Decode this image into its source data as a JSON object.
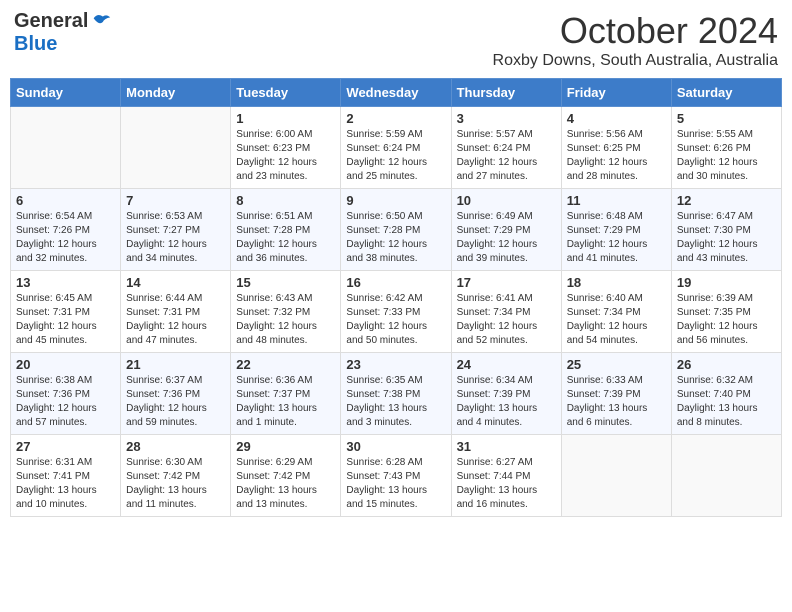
{
  "header": {
    "logo_general": "General",
    "logo_blue": "Blue",
    "month": "October 2024",
    "location": "Roxby Downs, South Australia, Australia"
  },
  "days_of_week": [
    "Sunday",
    "Monday",
    "Tuesday",
    "Wednesday",
    "Thursday",
    "Friday",
    "Saturday"
  ],
  "weeks": [
    [
      {
        "day": "",
        "sunrise": "",
        "sunset": "",
        "daylight": ""
      },
      {
        "day": "",
        "sunrise": "",
        "sunset": "",
        "daylight": ""
      },
      {
        "day": "1",
        "sunrise": "Sunrise: 6:00 AM",
        "sunset": "Sunset: 6:23 PM",
        "daylight": "Daylight: 12 hours and 23 minutes."
      },
      {
        "day": "2",
        "sunrise": "Sunrise: 5:59 AM",
        "sunset": "Sunset: 6:24 PM",
        "daylight": "Daylight: 12 hours and 25 minutes."
      },
      {
        "day": "3",
        "sunrise": "Sunrise: 5:57 AM",
        "sunset": "Sunset: 6:24 PM",
        "daylight": "Daylight: 12 hours and 27 minutes."
      },
      {
        "day": "4",
        "sunrise": "Sunrise: 5:56 AM",
        "sunset": "Sunset: 6:25 PM",
        "daylight": "Daylight: 12 hours and 28 minutes."
      },
      {
        "day": "5",
        "sunrise": "Sunrise: 5:55 AM",
        "sunset": "Sunset: 6:26 PM",
        "daylight": "Daylight: 12 hours and 30 minutes."
      }
    ],
    [
      {
        "day": "6",
        "sunrise": "Sunrise: 6:54 AM",
        "sunset": "Sunset: 7:26 PM",
        "daylight": "Daylight: 12 hours and 32 minutes."
      },
      {
        "day": "7",
        "sunrise": "Sunrise: 6:53 AM",
        "sunset": "Sunset: 7:27 PM",
        "daylight": "Daylight: 12 hours and 34 minutes."
      },
      {
        "day": "8",
        "sunrise": "Sunrise: 6:51 AM",
        "sunset": "Sunset: 7:28 PM",
        "daylight": "Daylight: 12 hours and 36 minutes."
      },
      {
        "day": "9",
        "sunrise": "Sunrise: 6:50 AM",
        "sunset": "Sunset: 7:28 PM",
        "daylight": "Daylight: 12 hours and 38 minutes."
      },
      {
        "day": "10",
        "sunrise": "Sunrise: 6:49 AM",
        "sunset": "Sunset: 7:29 PM",
        "daylight": "Daylight: 12 hours and 39 minutes."
      },
      {
        "day": "11",
        "sunrise": "Sunrise: 6:48 AM",
        "sunset": "Sunset: 7:29 PM",
        "daylight": "Daylight: 12 hours and 41 minutes."
      },
      {
        "day": "12",
        "sunrise": "Sunrise: 6:47 AM",
        "sunset": "Sunset: 7:30 PM",
        "daylight": "Daylight: 12 hours and 43 minutes."
      }
    ],
    [
      {
        "day": "13",
        "sunrise": "Sunrise: 6:45 AM",
        "sunset": "Sunset: 7:31 PM",
        "daylight": "Daylight: 12 hours and 45 minutes."
      },
      {
        "day": "14",
        "sunrise": "Sunrise: 6:44 AM",
        "sunset": "Sunset: 7:31 PM",
        "daylight": "Daylight: 12 hours and 47 minutes."
      },
      {
        "day": "15",
        "sunrise": "Sunrise: 6:43 AM",
        "sunset": "Sunset: 7:32 PM",
        "daylight": "Daylight: 12 hours and 48 minutes."
      },
      {
        "day": "16",
        "sunrise": "Sunrise: 6:42 AM",
        "sunset": "Sunset: 7:33 PM",
        "daylight": "Daylight: 12 hours and 50 minutes."
      },
      {
        "day": "17",
        "sunrise": "Sunrise: 6:41 AM",
        "sunset": "Sunset: 7:34 PM",
        "daylight": "Daylight: 12 hours and 52 minutes."
      },
      {
        "day": "18",
        "sunrise": "Sunrise: 6:40 AM",
        "sunset": "Sunset: 7:34 PM",
        "daylight": "Daylight: 12 hours and 54 minutes."
      },
      {
        "day": "19",
        "sunrise": "Sunrise: 6:39 AM",
        "sunset": "Sunset: 7:35 PM",
        "daylight": "Daylight: 12 hours and 56 minutes."
      }
    ],
    [
      {
        "day": "20",
        "sunrise": "Sunrise: 6:38 AM",
        "sunset": "Sunset: 7:36 PM",
        "daylight": "Daylight: 12 hours and 57 minutes."
      },
      {
        "day": "21",
        "sunrise": "Sunrise: 6:37 AM",
        "sunset": "Sunset: 7:36 PM",
        "daylight": "Daylight: 12 hours and 59 minutes."
      },
      {
        "day": "22",
        "sunrise": "Sunrise: 6:36 AM",
        "sunset": "Sunset: 7:37 PM",
        "daylight": "Daylight: 13 hours and 1 minute."
      },
      {
        "day": "23",
        "sunrise": "Sunrise: 6:35 AM",
        "sunset": "Sunset: 7:38 PM",
        "daylight": "Daylight: 13 hours and 3 minutes."
      },
      {
        "day": "24",
        "sunrise": "Sunrise: 6:34 AM",
        "sunset": "Sunset: 7:39 PM",
        "daylight": "Daylight: 13 hours and 4 minutes."
      },
      {
        "day": "25",
        "sunrise": "Sunrise: 6:33 AM",
        "sunset": "Sunset: 7:39 PM",
        "daylight": "Daylight: 13 hours and 6 minutes."
      },
      {
        "day": "26",
        "sunrise": "Sunrise: 6:32 AM",
        "sunset": "Sunset: 7:40 PM",
        "daylight": "Daylight: 13 hours and 8 minutes."
      }
    ],
    [
      {
        "day": "27",
        "sunrise": "Sunrise: 6:31 AM",
        "sunset": "Sunset: 7:41 PM",
        "daylight": "Daylight: 13 hours and 10 minutes."
      },
      {
        "day": "28",
        "sunrise": "Sunrise: 6:30 AM",
        "sunset": "Sunset: 7:42 PM",
        "daylight": "Daylight: 13 hours and 11 minutes."
      },
      {
        "day": "29",
        "sunrise": "Sunrise: 6:29 AM",
        "sunset": "Sunset: 7:42 PM",
        "daylight": "Daylight: 13 hours and 13 minutes."
      },
      {
        "day": "30",
        "sunrise": "Sunrise: 6:28 AM",
        "sunset": "Sunset: 7:43 PM",
        "daylight": "Daylight: 13 hours and 15 minutes."
      },
      {
        "day": "31",
        "sunrise": "Sunrise: 6:27 AM",
        "sunset": "Sunset: 7:44 PM",
        "daylight": "Daylight: 13 hours and 16 minutes."
      },
      {
        "day": "",
        "sunrise": "",
        "sunset": "",
        "daylight": ""
      },
      {
        "day": "",
        "sunrise": "",
        "sunset": "",
        "daylight": ""
      }
    ]
  ]
}
